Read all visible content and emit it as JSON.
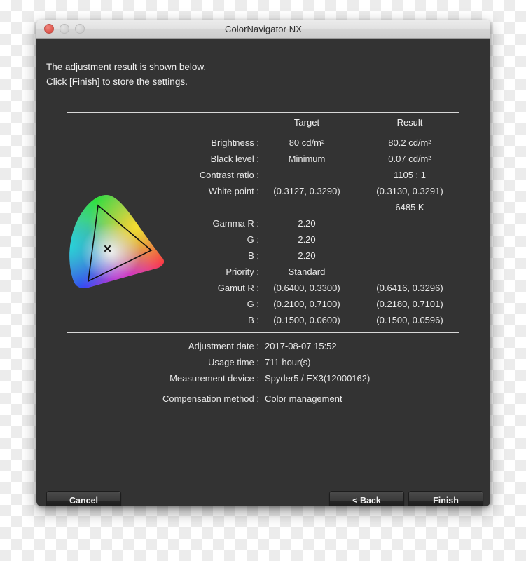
{
  "window": {
    "title": "ColorNavigator NX",
    "traffic_lights": [
      "close",
      "minimize",
      "maximize"
    ]
  },
  "intro": {
    "text": "The adjustment result is shown below.\nClick [Finish] to store the settings."
  },
  "table": {
    "columns": [
      "",
      "Target",
      "Result"
    ],
    "rows": [
      {
        "label": "Brightness :",
        "target": "80 cd/m²",
        "result": "80.2 cd/m²"
      },
      {
        "label": "Black level :",
        "target": "Minimum",
        "result": "0.07 cd/m²"
      },
      {
        "label": "Contrast ratio :",
        "target": "",
        "result": "1105 : 1"
      },
      {
        "label": "White point :",
        "target": "(0.3127, 0.3290)",
        "result": "(0.3130, 0.3291)"
      },
      {
        "label": "",
        "target": "",
        "result": "6485 K"
      },
      {
        "label": "Gamma R :",
        "target": "2.20",
        "result": ""
      },
      {
        "label": "G :",
        "target": "2.20",
        "result": ""
      },
      {
        "label": "B :",
        "target": "2.20",
        "result": ""
      },
      {
        "label": "Priority :",
        "target": "Standard",
        "result": ""
      },
      {
        "label": "Gamut R :",
        "target": "(0.6400, 0.3300)",
        "result": "(0.6416, 0.3296)"
      },
      {
        "label": "G :",
        "target": "(0.2100, 0.7100)",
        "result": "(0.2180, 0.7101)"
      },
      {
        "label": "B :",
        "target": "(0.1500, 0.0600)",
        "result": "(0.1500, 0.0596)"
      }
    ]
  },
  "info": {
    "rows": [
      {
        "label": "Adjustment date :",
        "value": "2017-08-07 15:52"
      },
      {
        "label": "Usage time :",
        "value": "711 hour(s)"
      },
      {
        "label": "Measurement device :",
        "value": "Spyder5 / EX3(12000162)"
      },
      {
        "label": "Compensation method :",
        "value": "Color management"
      }
    ]
  },
  "diagram": {
    "name": "cie-chromaticity-diagram",
    "white_point_marker": "×"
  },
  "buttons": {
    "cancel": "Cancel",
    "back": "< Back",
    "finish": "Finish"
  },
  "colors": {
    "window_body": "#333333",
    "titlebar": "#e2e2e2",
    "rule": "#d8d8d8",
    "close_button": "#e05a51"
  }
}
